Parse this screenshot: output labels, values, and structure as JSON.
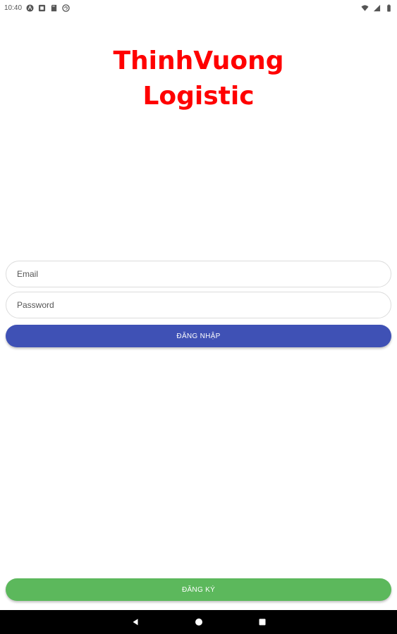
{
  "status_bar": {
    "time": "10:40",
    "left_icons": [
      "android-notification-icon",
      "app-notification-icon",
      "sd-card-icon",
      "sync-icon"
    ],
    "right_icons": [
      "wifi-icon",
      "signal-icon",
      "battery-icon"
    ]
  },
  "app": {
    "title_line1": "ThinhVuong",
    "title_line2": "Logistic"
  },
  "form": {
    "email_placeholder": "Email",
    "password_placeholder": "Password",
    "login_label": "ĐĂNG NHẬP"
  },
  "footer": {
    "register_label": "ĐĂNG KÝ"
  },
  "nav_bar": {
    "buttons": [
      "back-icon",
      "home-icon",
      "recents-icon"
    ]
  },
  "colors": {
    "title": "#ff0000",
    "login_button": "#3f51b5",
    "register_button": "#5cb85c",
    "nav_bar": "#000000"
  }
}
